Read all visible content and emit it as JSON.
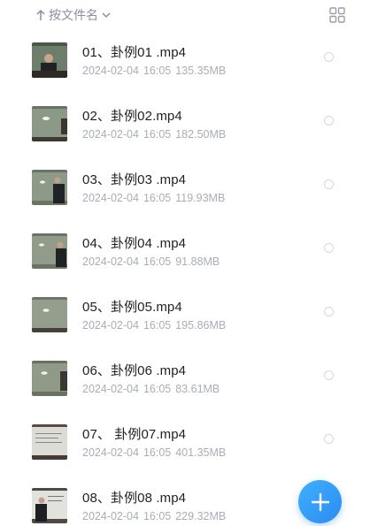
{
  "toolbar": {
    "sort_label": "按文件名",
    "sort_direction_icon": "arrow-up-icon",
    "sort_dropdown_icon": "chevron-down-icon",
    "view_toggle_icon": "grid-view-icon"
  },
  "files": [
    {
      "name": "01、卦例01 .mp4",
      "date": "2024-02-04",
      "time": "16:05",
      "size": "135.35MB"
    },
    {
      "name": "02、卦例02.mp4",
      "date": "2024-02-04",
      "time": "16:05",
      "size": "182.50MB"
    },
    {
      "name": "03、卦例03 .mp4",
      "date": "2024-02-04",
      "time": "16:05",
      "size": "119.93MB"
    },
    {
      "name": "04、卦例04 .mp4",
      "date": "2024-02-04",
      "time": "16:05",
      "size": "91.88MB"
    },
    {
      "name": "05、卦例05.mp4",
      "date": "2024-02-04",
      "time": "16:05",
      "size": "195.86MB"
    },
    {
      "name": "06、卦例06 .mp4",
      "date": "2024-02-04",
      "time": "16:05",
      "size": "83.61MB"
    },
    {
      "name": "07、 卦例07.mp4",
      "date": "2024-02-04",
      "time": "16:05",
      "size": "401.35MB"
    },
    {
      "name": "08、卦例08 .mp4",
      "date": "2024-02-04",
      "time": "16:05",
      "size": "229.32MB"
    }
  ],
  "fab": {
    "icon": "plus-icon",
    "color": "#2f9cf8"
  }
}
